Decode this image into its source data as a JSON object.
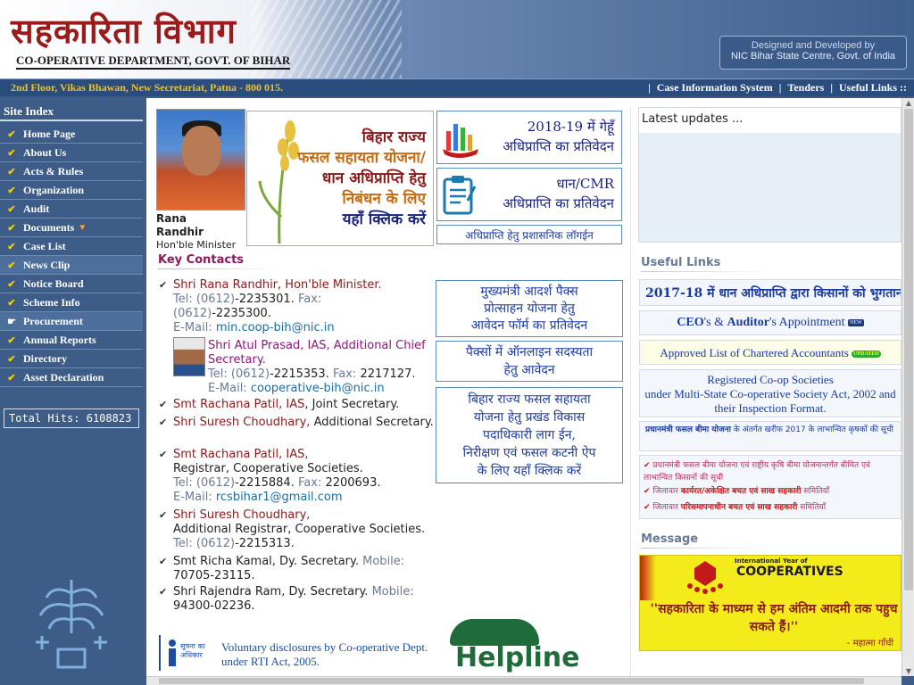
{
  "header": {
    "hindi_title": "सहकारिता विभाग",
    "english_title": "CO-OPERATIVE DEPARTMENT, GOVT. OF BIHAR",
    "designed_by_line1": "Designed and Developed by",
    "designed_by_line2": "NIC Bihar State Centre, Govt. of India"
  },
  "address_bar": {
    "address": "2nd Floor, Vikas Bhawan, New Secretariat, Patna - 800 015.",
    "links": [
      "Case Information System",
      "Tenders",
      "Useful Links ::"
    ]
  },
  "sidebar": {
    "title": "Site Index",
    "items": [
      {
        "label": "Home Page"
      },
      {
        "label": "About Us"
      },
      {
        "label": "Acts & Rules"
      },
      {
        "label": "Organization"
      },
      {
        "label": "Audit"
      },
      {
        "label": "Documents"
      },
      {
        "label": "Case List"
      },
      {
        "label": "News Clip"
      },
      {
        "label": "Notice Board"
      },
      {
        "label": "Scheme Info"
      },
      {
        "label": "Procurement"
      },
      {
        "label": "Annual Reports"
      },
      {
        "label": "Directory"
      },
      {
        "label": "Asset Declaration"
      }
    ],
    "hits_label": "Total Hits:",
    "hits_value": "6108823"
  },
  "minister": {
    "name": "Rana Randhir",
    "role": "Hon'ble Minister"
  },
  "banners": {
    "fasal_lines": [
      "बिहार राज्य",
      "फसल सहायता योजना/",
      "धान अधिप्राप्ति हेतु",
      "निबंधन के लिए",
      "यहाँ क्लिक करें"
    ],
    "wheat_line1": "2018-19 में गेहूँ",
    "wheat_line2": "अधिप्राप्ति का प्रतिवेदन",
    "dhan_line1": "धान/CMR",
    "dhan_line2": "अधिप्राप्ति का प्रतिवेदन",
    "login_text": "अधिप्राप्ति हेतु प्रशासनिक लॉगईन"
  },
  "latest_updates": {
    "title": "Latest updates ..."
  },
  "key_contacts": {
    "title": "Key Contacts",
    "c1_name": "Shri Rana Randhir, Hon'ble Minister.",
    "c1_tel_label": "Tel:",
    "c1_tel_code": "(0612)",
    "c1_tel": "-2235301.",
    "c1_fax_label": "Fax:",
    "c1_fax_code": "(0612)",
    "c1_fax": "-2235300.",
    "c1_email_label": "E-Mail:",
    "c1_email": "min.coop-bih@nic.in",
    "c2_name": "Shri Atul Prasad, IAS, Additional Chief Secretary.",
    "c2_tel_label": "Tel:",
    "c2_tel_code": "(0612)",
    "c2_tel": "-2215353",
    "c2_fax_label": "Fax:",
    "c2_fax": "2217127.",
    "c2_email_label": "E-Mail:",
    "c2_email": "cooperative-bih@nic.in",
    "c3_name": "Smt Rachana Patil, IAS",
    "c3_role": ", Joint Secretary.",
    "c4_name": "Shri Suresh Choudhary,",
    "c4_role": "Additional Secretary.",
    "c5_name": "Smt Rachana Patil, IAS,",
    "c5_role": "Registrar, Cooperative Societies.",
    "c5_tel_label": "Tel:",
    "c5_tel_code": "(0612)",
    "c5_tel": "-2215884.",
    "c5_fax_label": "Fax:",
    "c5_fax": "2200693.",
    "c5_email_label": "E-Mail:",
    "c5_email": "rcsbihar1@gmail.com",
    "c6_name": "Shri Suresh Choudhary,",
    "c6_role": "Additional Registrar, Cooperative Societies.",
    "c6_tel_label": "Tel:",
    "c6_tel_code": "(0612)",
    "c6_tel": "-2215313",
    "c7_text": "Smt Richa Kamal, Dy. Secretary.",
    "c7_mobile_label": "Mobile:",
    "c7_mobile": "70705-23115.",
    "c8_text": "Shri Rajendra Ram, Dy. Secretary.",
    "c8_mobile_label": "Mobile:",
    "c8_mobile": "94300-02236."
  },
  "right_boxes": {
    "adarsh": [
      "मुख्यमंत्री आदर्श पैक्स",
      "प्रोत्साहन योजना हेतु",
      "आवेदन फॉर्म का प्रतिवेदन"
    ],
    "online": [
      "पैक्सों में ऑनलाइन सदस्यता",
      "हेतु आवेदन"
    ],
    "fasal": [
      "बिहार राज्य फसल सहायता",
      "योजना हेतु प्रखंड विकास",
      "पदाधिकारी लाग ईन,",
      "निरीक्षण एवं फसल कटनी ऐप",
      "के लिए यहाँ क्लिक करें"
    ]
  },
  "rti": {
    "logo_text1": "सूचना का",
    "logo_text2": "अधिकार",
    "line1": "Voluntary disclosures by Co-operative Dept.",
    "line2": "under RTI Act, 2005."
  },
  "helpline": {
    "text": "Helpline"
  },
  "useful_links": {
    "title": "Useful Links",
    "l1": "2017-18 में धान अधिप्राप्ति द्वारा किसानों को भुगतान",
    "l2_a": "CEO",
    "l2_b": "'s & ",
    "l2_c": "Auditor",
    "l2_d": "'s Appointment",
    "new_badge": "NEW",
    "l3": "Approved List of Chartered Accountants",
    "updated_badge": "UPDATED",
    "l4_1": "Registered Co-op Societies",
    "l4_2": "under Multi-State Co-operative Society Act, 2002 and",
    "l4_3": "their Inspection Format.",
    "l5_bold": "प्रधानमंत्री फसल बीमा योजना",
    "l5_rest": "के अंतर्गत खरीफ 2017 के लाभान्वित कृषकों की सूची",
    "l6": "प्रधानमंत्री फसल बीमा योजना एवं राष्ट्रीय कृषि बीमा योजनान्तर्गत बीमित एवं लाभान्वित किसानों की सूची",
    "l7_a": "जिलावार ",
    "l7_b": "कार्यरत/अकेक्षित बचत एवं साख सहकारी",
    "l7_c": " समितियाँ",
    "l8_a": "जिलावार ",
    "l8_b": "परिसमापनाधीन बचत एवं साख सहकारी",
    "l8_c": " समितियाँ"
  },
  "message": {
    "title": "Message",
    "iy_text": "International Year of",
    "coop_text": "COOPERATIVES",
    "quote": "''सहकारिता के माध्यम से हम अंतिम आदमी तक पहुच सकते हैं।''",
    "signature": "- महात्मा गाँधी"
  }
}
